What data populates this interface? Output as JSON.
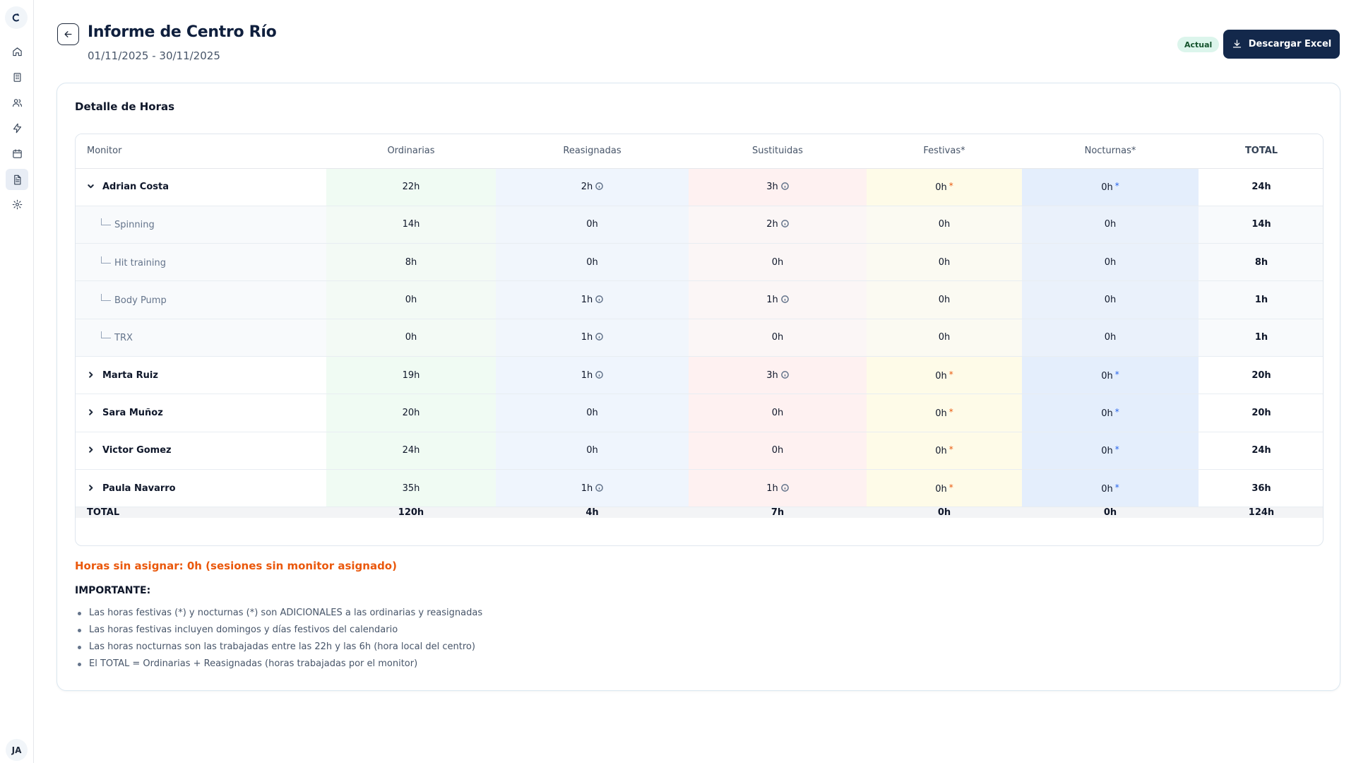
{
  "sidebar": {
    "logo_glyph": "c",
    "items": [
      {
        "name": "home-icon"
      },
      {
        "name": "building-icon"
      },
      {
        "name": "users-icon"
      },
      {
        "name": "lightning-icon"
      },
      {
        "name": "calendar-icon"
      },
      {
        "name": "document-icon",
        "active": true
      },
      {
        "name": "gear-icon"
      }
    ],
    "avatar": "JA"
  },
  "header": {
    "title": "Informe de Centro Río",
    "dates": "01/11/2025 - 30/11/2025",
    "badge": "Actual",
    "download_label": "Descargar Excel"
  },
  "card": {
    "title": "Detalle de Horas"
  },
  "table": {
    "columns": [
      "Monitor",
      "Ordinarias",
      "Reasignadas",
      "Sustituidas",
      "Festivas*",
      "Nocturnas*",
      "TOTAL"
    ],
    "rows": [
      {
        "type": "parent",
        "expanded": true,
        "name": "Adrian Costa",
        "ord": "22h",
        "rea": "2h",
        "rea_info": true,
        "sus": "3h",
        "sus_info": true,
        "fes": "0h",
        "noc": "0h",
        "total": "24h"
      },
      {
        "type": "child",
        "name": "Spinning",
        "ord": "14h",
        "rea": "0h",
        "sus": "2h",
        "sus_info": true,
        "fes": "0h",
        "noc": "0h",
        "total": "14h"
      },
      {
        "type": "child",
        "name": "Hit training",
        "ord": "8h",
        "rea": "0h",
        "sus": "0h",
        "fes": "0h",
        "noc": "0h",
        "total": "8h"
      },
      {
        "type": "child",
        "name": "Body Pump",
        "ord": "0h",
        "rea": "1h",
        "rea_info": true,
        "sus": "1h",
        "sus_info": true,
        "fes": "0h",
        "noc": "0h",
        "total": "1h"
      },
      {
        "type": "child",
        "name": "TRX",
        "ord": "0h",
        "rea": "1h",
        "rea_info": true,
        "sus": "0h",
        "fes": "0h",
        "noc": "0h",
        "total": "1h"
      },
      {
        "type": "parent",
        "expanded": false,
        "name": "Marta Ruiz",
        "ord": "19h",
        "rea": "1h",
        "rea_info": true,
        "sus": "3h",
        "sus_info": true,
        "fes": "0h",
        "noc": "0h",
        "total": "20h"
      },
      {
        "type": "parent",
        "expanded": false,
        "name": "Sara Muñoz",
        "ord": "20h",
        "rea": "0h",
        "sus": "0h",
        "fes": "0h",
        "noc": "0h",
        "total": "20h"
      },
      {
        "type": "parent",
        "expanded": false,
        "name": "Victor Gomez",
        "ord": "24h",
        "rea": "0h",
        "sus": "0h",
        "fes": "0h",
        "noc": "0h",
        "total": "24h"
      },
      {
        "type": "parent",
        "expanded": false,
        "name": "Paula Navarro",
        "ord": "35h",
        "rea": "1h",
        "rea_info": true,
        "sus": "1h",
        "sus_info": true,
        "fes": "0h",
        "noc": "0h",
        "total": "36h"
      }
    ],
    "totals": {
      "label": "TOTAL",
      "ord": "120h",
      "rea": "4h",
      "sus": "7h",
      "fes": "0h",
      "noc": "0h",
      "total": "124h"
    },
    "star_glyph": "*"
  },
  "footer": {
    "unassigned": "Horas sin asignar: 0h (sesiones sin monitor asignado)",
    "important_title": "IMPORTANTE:",
    "notes": [
      "Las horas festivas (*) y nocturnas (*) son ADICIONALES a las ordinarias y reasignadas",
      "Las horas festivas incluyen domingos y días festivos del calendario",
      "Las horas nocturnas son las trabajadas entre las 22h y las 6h (hora local del centro)",
      "El TOTAL = Ordinarias + Reasignadas (horas trabajadas por el monitor)"
    ]
  },
  "colors": {
    "primary": "#13284b",
    "accent_orange": "#ea580c",
    "accent_blue": "#2563eb",
    "badge_bg": "#dcf5ec"
  }
}
